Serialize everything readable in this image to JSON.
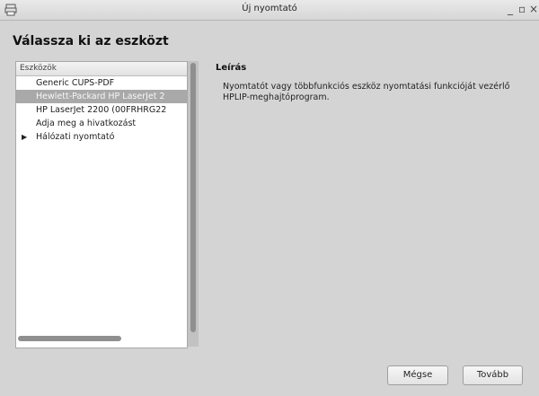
{
  "window": {
    "title": "Új nyomtató",
    "minimize": "_",
    "maximize": "▫",
    "close": "×"
  },
  "page": {
    "heading": "Válassza ki az eszközt"
  },
  "device_list": {
    "header": "Eszközök",
    "items": [
      {
        "label": "Generic CUPS-PDF",
        "selected": false,
        "expandable": false
      },
      {
        "label": "Hewlett-Packard HP LaserJet 2",
        "selected": true,
        "expandable": false
      },
      {
        "label": "HP LaserJet 2200 (00FRHRG22",
        "selected": false,
        "expandable": false
      },
      {
        "label": "Adja meg a hivatkozást",
        "selected": false,
        "expandable": false
      },
      {
        "label": "Hálózati nyomtató",
        "selected": false,
        "expandable": true
      }
    ]
  },
  "description": {
    "title": "Leírás",
    "text": "Nyomtatót vagy többfunkciós eszköz nyomtatási funkcióját vezérlő HPLIP-meghajtóprogram."
  },
  "buttons": {
    "cancel": "Mégse",
    "next": "Tovább"
  }
}
